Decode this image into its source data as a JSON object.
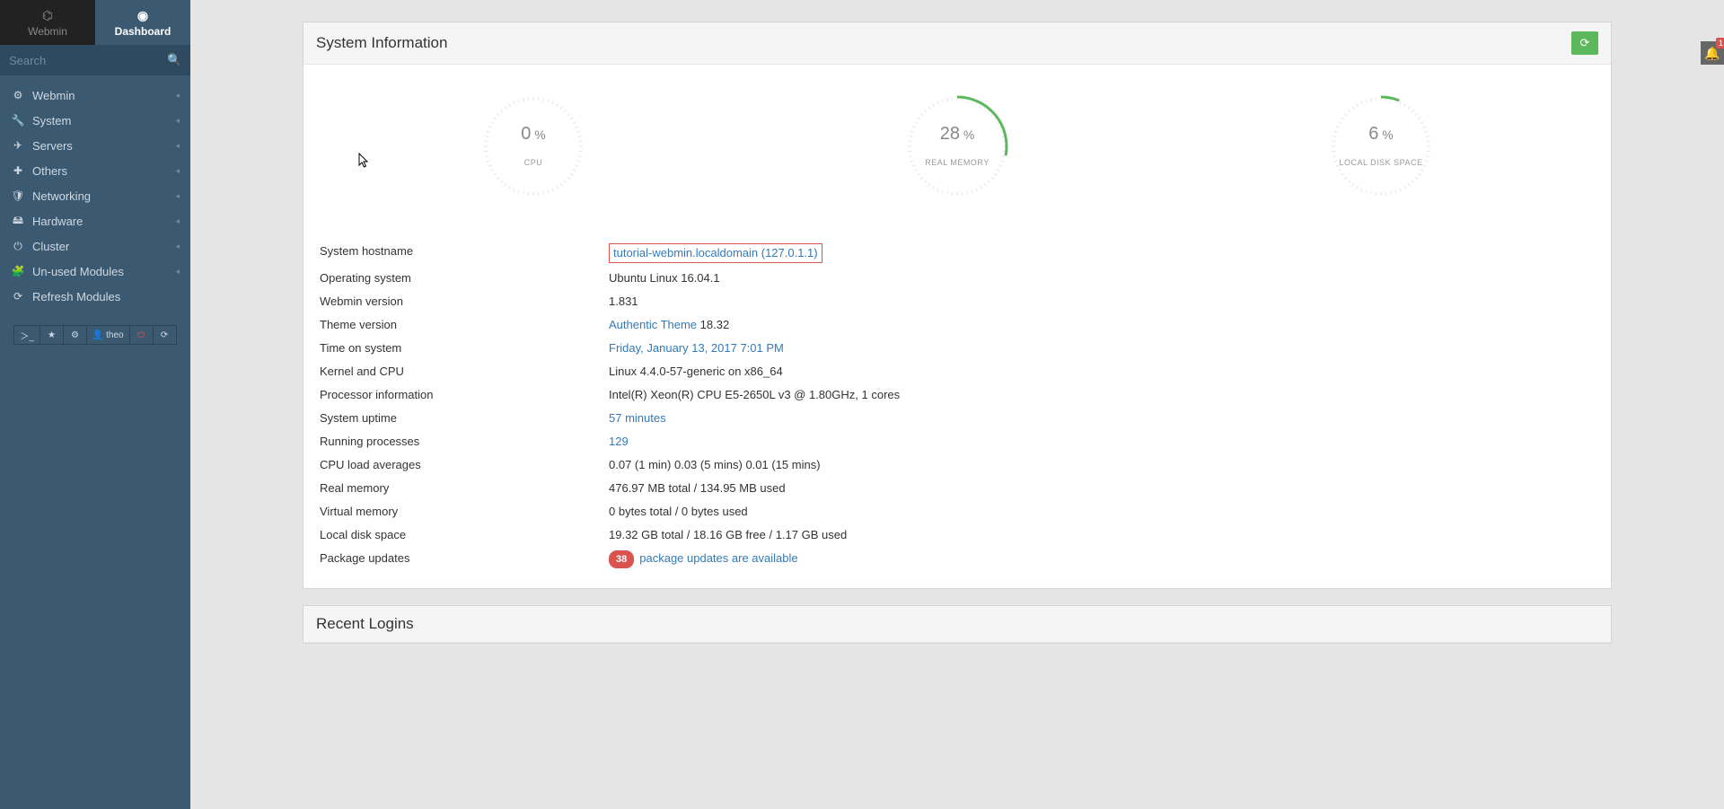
{
  "tabs": {
    "inactive": "Webmin",
    "active": "Dashboard"
  },
  "search": {
    "placeholder": "Search"
  },
  "nav": [
    {
      "icon": "⚙",
      "label": "Webmin",
      "caret": true
    },
    {
      "icon": "🔧",
      "label": "System",
      "caret": true
    },
    {
      "icon": "✈",
      "label": "Servers",
      "caret": true
    },
    {
      "icon": "✚",
      "label": "Others",
      "caret": true
    },
    {
      "icon": "🛡",
      "label": "Networking",
      "caret": true
    },
    {
      "icon": "🖴",
      "label": "Hardware",
      "caret": true
    },
    {
      "icon": "⏻",
      "label": "Cluster",
      "caret": true
    },
    {
      "icon": "🧩",
      "label": "Un-used Modules",
      "caret": true
    },
    {
      "icon": "⟳",
      "label": "Refresh Modules",
      "caret": false
    }
  ],
  "bottom_buttons": [
    "＞_",
    "★",
    "⚙",
    "👤 theo",
    "⏻",
    "⟳"
  ],
  "panel_title": "System Information",
  "gauges": [
    {
      "value": 0,
      "label": "CPU"
    },
    {
      "value": 28,
      "label": "REAL MEMORY"
    },
    {
      "value": 6,
      "label": "LOCAL DISK SPACE"
    }
  ],
  "info": [
    {
      "k": "System hostname",
      "v": "tutorial-webmin.localdomain (127.0.1.1)",
      "link": true,
      "boxed": true
    },
    {
      "k": "Operating system",
      "v": "Ubuntu Linux 16.04.1"
    },
    {
      "k": "Webmin version",
      "v": "1.831"
    },
    {
      "k": "Theme version",
      "v_pre": "Authentic Theme",
      "v_post": " 18.32",
      "linkpre": true
    },
    {
      "k": "Time on system",
      "v": "Friday, January 13, 2017 7:01 PM",
      "link": true
    },
    {
      "k": "Kernel and CPU",
      "v": "Linux 4.4.0-57-generic on x86_64"
    },
    {
      "k": "Processor information",
      "v": "Intel(R) Xeon(R) CPU E5-2650L v3 @ 1.80GHz, 1 cores"
    },
    {
      "k": "System uptime",
      "v": "57 minutes",
      "link": true
    },
    {
      "k": "Running processes",
      "v": "129",
      "link": true
    },
    {
      "k": "CPU load averages",
      "v": "0.07 (1 min) 0.03 (5 mins) 0.01 (15 mins)"
    },
    {
      "k": "Real memory",
      "v": "476.97 MB total / 134.95 MB used"
    },
    {
      "k": "Virtual memory",
      "v": "0 bytes total / 0 bytes used"
    },
    {
      "k": "Local disk space",
      "v": "19.32 GB total / 18.16 GB free / 1.17 GB used"
    },
    {
      "k": "Package updates",
      "badge": "38",
      "v": "package updates are available",
      "link": true
    }
  ],
  "recent_panel": "Recent Logins",
  "notif_count": "1"
}
